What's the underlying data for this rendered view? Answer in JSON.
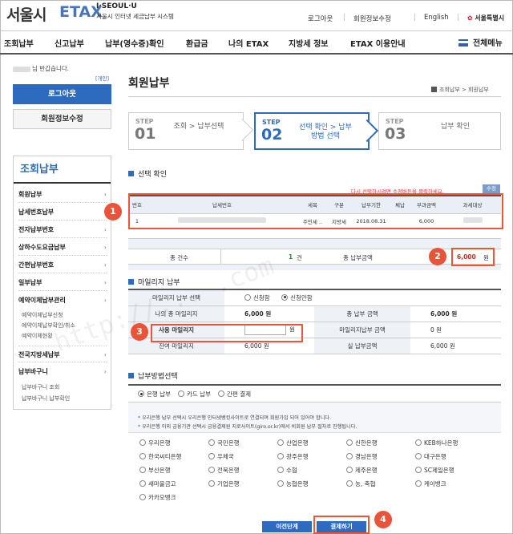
{
  "header": {
    "logo_main": "서울시",
    "logo_etax": "ETAX",
    "logo_sub_top": "I·SEOUL·U",
    "logo_sub_bottom": "서울시 인터넷 세금납부 시스템",
    "links": [
      "로그아웃",
      "회원정보수정",
      "English"
    ],
    "seoul_mark": "서울특별시"
  },
  "nav": {
    "items": [
      "조회납부",
      "신고납부",
      "납부(영수증)확인",
      "환급금",
      "나의 ETAX",
      "지방세 정보",
      "ETAX 이용안내"
    ],
    "menu_label": "전체메뉴"
  },
  "left": {
    "greeting": "님 반갑습니다.",
    "reopen": "[개인]",
    "logout": "로그아웃",
    "edit_info": "회원정보수정",
    "side_title": "조회납부",
    "items": [
      "회원납부",
      "납세번호납부",
      "전자납부번호",
      "상하수도요금납부",
      "간편납부번호",
      "일부납부",
      "예약이체납부관리"
    ],
    "sub1": [
      "예약이체납부신청",
      "예약이체납부확인/취소",
      "예약이체현황"
    ],
    "items2": [
      "전국지방세납부",
      "납부바구니"
    ],
    "sub2": [
      "납부바구니 조회",
      "납부바구니 납부확인"
    ]
  },
  "content": {
    "title": "회원납부",
    "breadcrumb": "조회납부 > 회원납부",
    "steps": [
      {
        "label": "STEP",
        "num": "01",
        "text": "조회 > 납부선택"
      },
      {
        "label": "STEP",
        "num": "02",
        "text": "선택 확인 > 납부방법 선택"
      },
      {
        "label": "STEP",
        "num": "03",
        "text": "납부 확인"
      }
    ],
    "sec1": "선택 확인",
    "notice": "다시 선택하시려면 수정버튼을 클릭하세요.",
    "edit": "수정",
    "table_headers": [
      "번호",
      "납세번호",
      "세목",
      "구분",
      "납부기한",
      "체납",
      "부과금액",
      "과세대상"
    ],
    "table_row": {
      "no": "1",
      "tax_type": "주민세 ..",
      "kind": "지방세",
      "due": "2018.08.31",
      "arrears": "",
      "amount": "6,000"
    },
    "total_count_label": "총 건수",
    "total_count": "1",
    "count_unit": "건",
    "total_amount_label": "총 납부금액",
    "total_amount": "6,000",
    "won": "원",
    "sec2": "마일리지 납부",
    "mileage": {
      "select_label": "마일리지 납부 선택",
      "opt_apply": "신청함",
      "opt_none": "신청안함",
      "my_total_label": "나의 총 마일리지",
      "my_total": "6,000 원",
      "total_pay_label": "총 납부 금액",
      "total_pay": "6,000 원",
      "use_label": "사용 마일리지",
      "use_unit": "원",
      "mile_pay_label": "마일리지납부 금액",
      "mile_pay": "0 원",
      "remain_label": "잔여 마일리지",
      "remain": "6,000 원",
      "actual_label": "실 납부금액",
      "actual": "6,000 원"
    },
    "sec3": "납부방법선택",
    "pay_opts": [
      "은행 납부",
      "카드 납부",
      "간편 결제"
    ],
    "hint1": "우리은행 납부 선택시 우리은행 인터넷뱅킹사이트로 연결되며 회원가입 되어 있어야 합니다.",
    "hint2": "우리은행 이외 금융기관 선택시 금융결제원 지로사이트(giro.or.kr)에서 비회원 납부 절차로 진행됩니다.",
    "banks": [
      "우리은행",
      "국민은행",
      "산업은행",
      "신한은행",
      "KEB하나은행",
      "한국씨티은행",
      "우체국",
      "광주은행",
      "경남은행",
      "대구은행",
      "부산은행",
      "전북은행",
      "수협",
      "제주은행",
      "SC제일은행",
      "새마을금고",
      "기업은행",
      "농협은행",
      "농, 축협",
      "케이뱅크",
      "카카오뱅크"
    ],
    "prev": "이전단계",
    "pay": "결제하기"
  },
  "badges": [
    "1",
    "2",
    "3",
    "4"
  ],
  "watermark": "http://... .com"
}
